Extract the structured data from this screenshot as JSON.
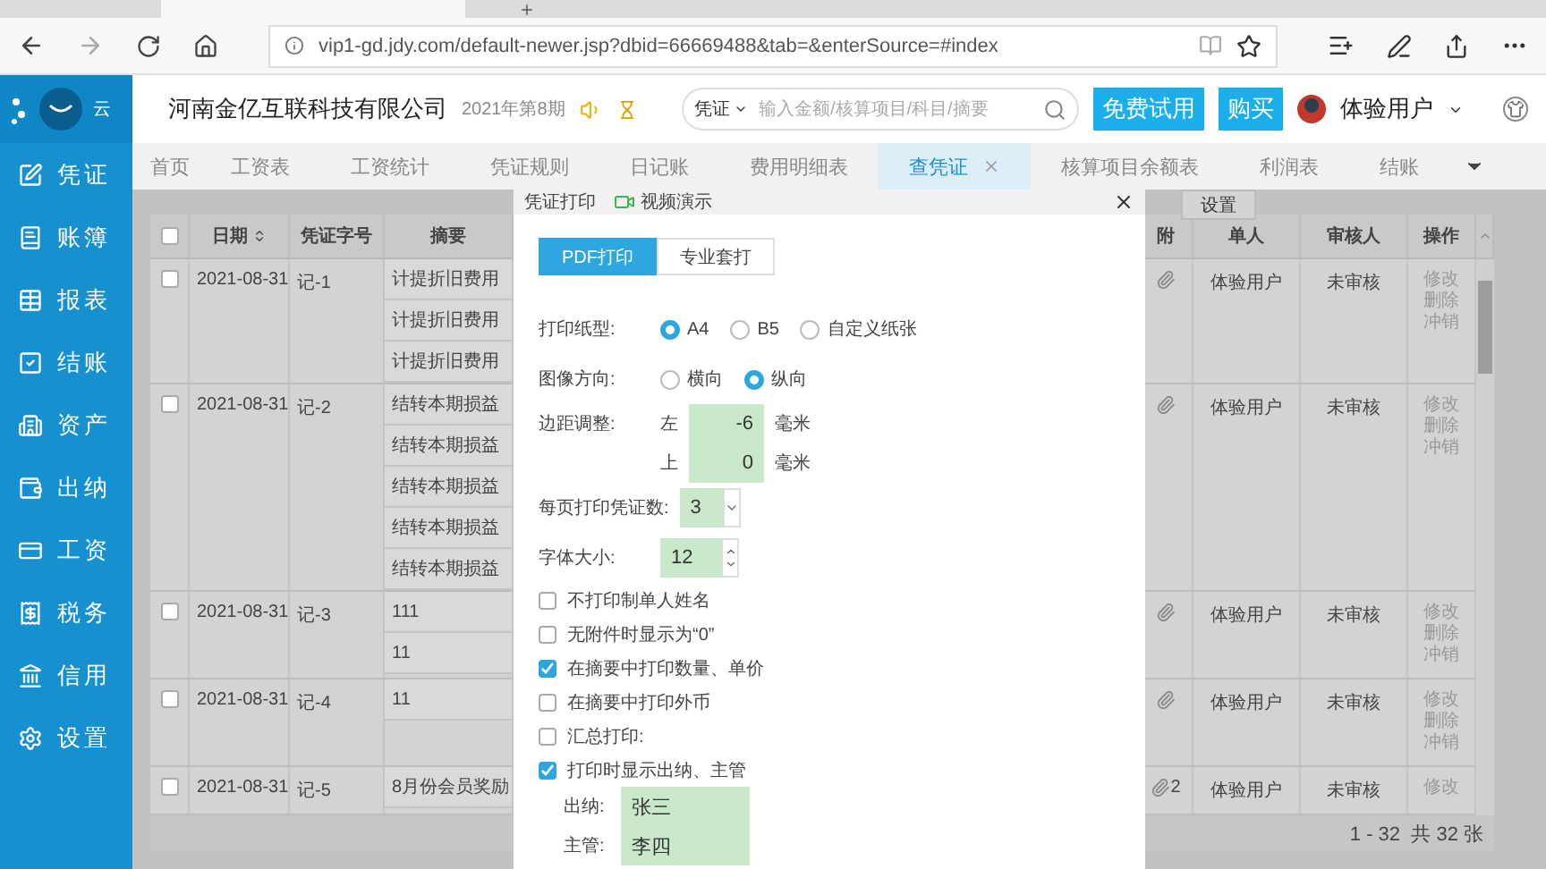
{
  "browser": {
    "url": "vip1-gd.jdy.com/default-newer.jsp?dbid=66669488&tab=&enterSource=#index"
  },
  "header": {
    "logo_text": "云",
    "company": "河南金亿互联科技有限公司",
    "period": "2021年第8期",
    "search": {
      "scope": "凭证",
      "placeholder": "输入金额/核算项目/科目/摘要"
    },
    "buttons": [
      "免费试用",
      "购买"
    ],
    "user": "体验用户"
  },
  "tabs": [
    {
      "label": "首页",
      "selected": false
    },
    {
      "label": "工资表",
      "selected": false
    },
    {
      "label": "工资统计",
      "selected": false
    },
    {
      "label": "凭证规则",
      "selected": false
    },
    {
      "label": "日记账",
      "selected": false
    },
    {
      "label": "费用明细表",
      "selected": false
    },
    {
      "label": "查凭证",
      "selected": true
    },
    {
      "label": "核算项目余额表",
      "selected": false
    },
    {
      "label": "利润表",
      "selected": false
    },
    {
      "label": "结账",
      "selected": false
    }
  ],
  "sidebar": {
    "items": [
      "凭证",
      "账簿",
      "报表",
      "结账",
      "资产",
      "出纳",
      "工资",
      "税务",
      "信用",
      "设置"
    ]
  },
  "table": {
    "select_all": false,
    "columns": [
      "日期",
      "凭证字号",
      "摘要",
      "附",
      "单人",
      "审核人",
      "操作"
    ],
    "rows": [
      {
        "checked": false,
        "date": "2021-08-31",
        "number": "记-1",
        "summaries": [
          "计提折旧费用",
          "计提折旧费用",
          "计提折旧费用"
        ],
        "maker": "体验用户",
        "reviewer": "未审核",
        "actions": [
          "修改",
          "删除",
          "冲销"
        ]
      },
      {
        "checked": false,
        "date": "2021-08-31",
        "number": "记-2",
        "summaries": [
          "结转本期损益",
          "结转本期损益",
          "结转本期损益",
          "结转本期损益",
          "结转本期损益"
        ],
        "maker": "体验用户",
        "reviewer": "未审核",
        "actions": [
          "修改",
          "删除",
          "冲销"
        ]
      },
      {
        "checked": false,
        "date": "2021-08-31",
        "number": "记-3",
        "summaries": [
          "111",
          "11"
        ],
        "maker": "体验用户",
        "reviewer": "未审核",
        "actions": [
          "修改",
          "删除",
          "冲销"
        ]
      },
      {
        "checked": false,
        "date": "2021-08-31",
        "number": "记-4",
        "summaries": [
          "11"
        ],
        "maker": "体验用户",
        "reviewer": "未审核",
        "actions": [
          "修改",
          "删除",
          "冲销"
        ]
      },
      {
        "checked": false,
        "date": "2021-08-31",
        "number": "记-5",
        "summaries": [
          "8月份会员奖励"
        ],
        "attachment_count": "2",
        "maker": "体验用户",
        "reviewer": "未审核",
        "actions": [
          "修改"
        ]
      }
    ],
    "pagination": "1 - 32  共 32 张"
  },
  "settings_popup": "设置",
  "dialog": {
    "title": "凭证打印",
    "video_link": "视频演示",
    "modes": [
      {
        "label": "PDF打印",
        "selected": true
      },
      {
        "label": "专业套打",
        "selected": false
      }
    ],
    "paper": {
      "label": "打印纸型:",
      "options": [
        {
          "label": "A4",
          "selected": true
        },
        {
          "label": "B5",
          "selected": false
        },
        {
          "label": "自定义纸张",
          "selected": false
        }
      ]
    },
    "orientation": {
      "label": "图像方向:",
      "options": [
        {
          "label": "横向",
          "selected": false
        },
        {
          "label": "纵向",
          "selected": true
        }
      ]
    },
    "margin": {
      "label": "边距调整:",
      "sides": [
        {
          "side": "左",
          "value": "-6",
          "unit": "毫米"
        },
        {
          "side": "上",
          "value": "0",
          "unit": "毫米"
        }
      ]
    },
    "per_page": {
      "label": "每页打印凭证数:",
      "value": "3"
    },
    "font_size": {
      "label": "字体大小:",
      "value": "12"
    },
    "options": [
      {
        "label": "不打印制单人姓名",
        "checked": false
      },
      {
        "label": "无附件时显示为“0”",
        "checked": false
      },
      {
        "label": "在摘要中打印数量、单价",
        "checked": true
      },
      {
        "label": "在摘要中打印外币",
        "checked": false
      },
      {
        "label": "汇总打印:",
        "checked": false
      },
      {
        "label": "打印时显示出纳、主管",
        "checked": true
      }
    ],
    "signers": [
      {
        "label": "出纳:",
        "value": "张三"
      },
      {
        "label": "主管:",
        "value": "李四"
      }
    ]
  }
}
